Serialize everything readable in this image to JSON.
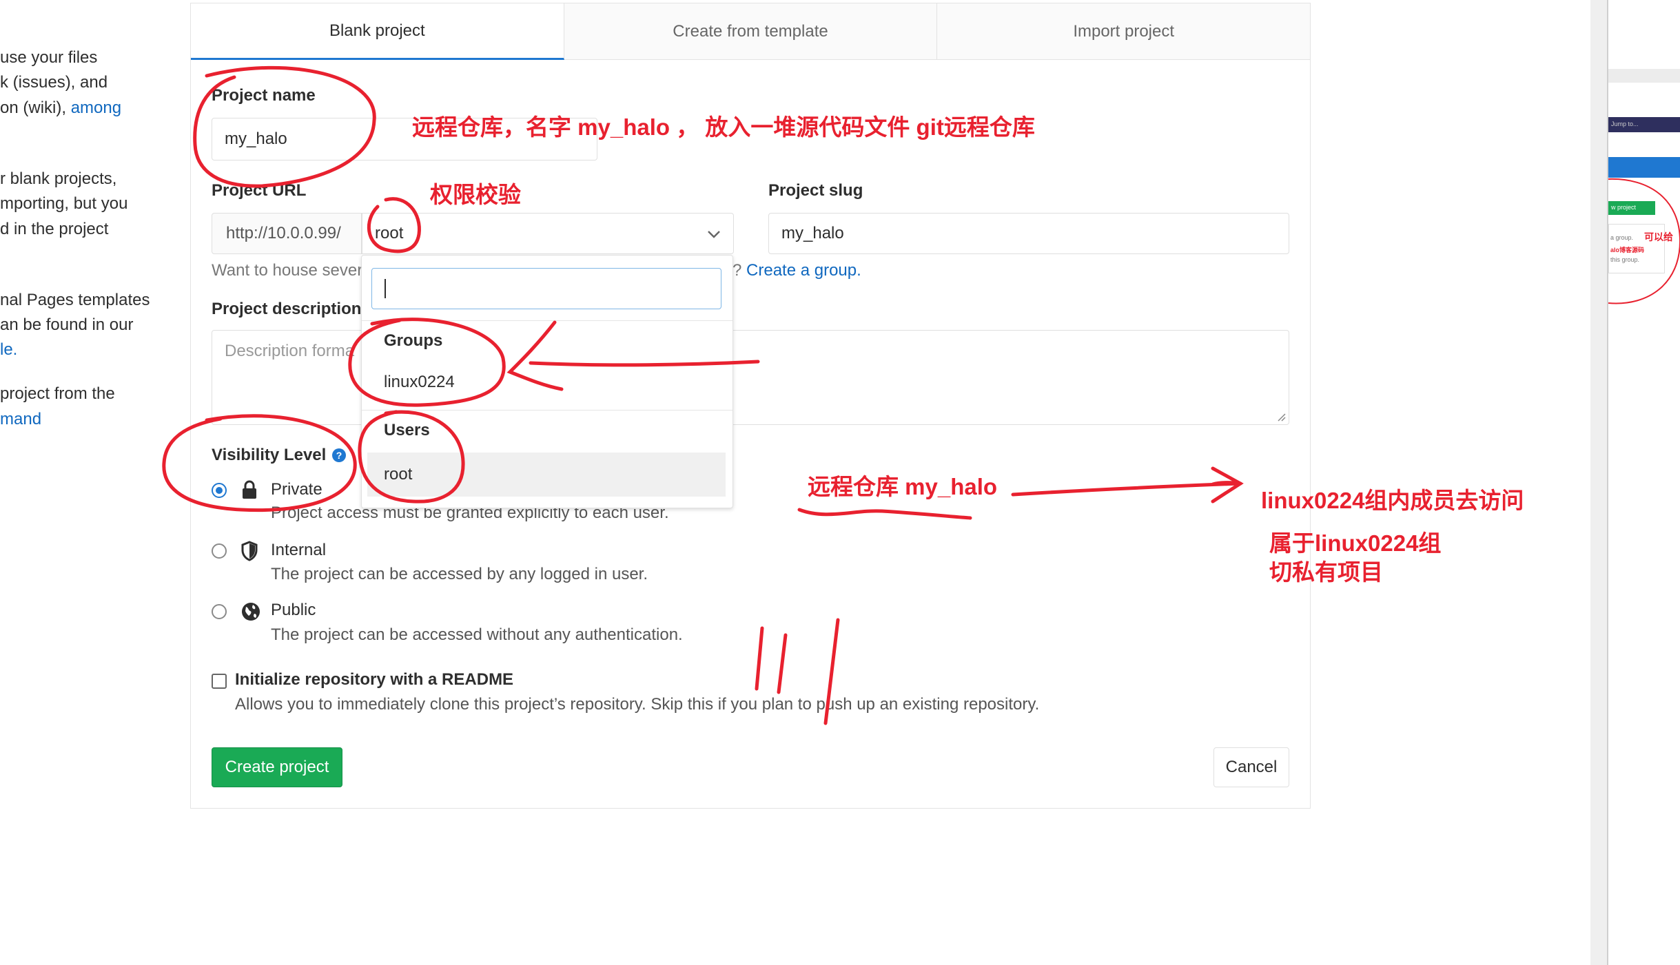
{
  "sidebar_text": [
    {
      "text": "use your files"
    },
    {
      "text": "k (issues), and"
    },
    {
      "text": "on (wiki), ",
      "link": "among"
    },
    {
      "text": "r blank projects,"
    },
    {
      "text": "mporting, but you"
    },
    {
      "text": "d in the project"
    },
    {
      "text": "nal Pages templates"
    },
    {
      "text": "an be found in our"
    },
    {
      "text": "",
      "link": "le."
    },
    {
      "text": "project from the"
    },
    {
      "text": "",
      "link": "mand"
    }
  ],
  "tabs": [
    "Blank project",
    "Create from template",
    "Import project"
  ],
  "form": {
    "project_name_label": "Project name",
    "project_name_value": "my_halo",
    "project_url_label": "Project URL",
    "url_prefix": "http://10.0.0.99/",
    "namespace_value": "root",
    "project_slug_label": "Project slug",
    "project_slug_value": "my_halo",
    "namespace_help_left": "Want to house sever",
    "namespace_help_right": "? ",
    "create_group_link": "Create a group.",
    "description_label": "Project description",
    "description_placeholder": "Description forma",
    "visibility_label": "Visibility Level",
    "visibility": [
      {
        "title": "Private",
        "desc": "Project access must be granted explicitly to each user.",
        "checked": true
      },
      {
        "title": "Internal",
        "desc": "The project can be accessed by any logged in user.",
        "checked": false
      },
      {
        "title": "Public",
        "desc": "The project can be accessed without any authentication.",
        "checked": false
      }
    ],
    "readme_label": "Initialize repository with a README",
    "readme_desc": "Allows you to immediately clone this project’s repository. Skip this if you plan to push up an existing repository.",
    "create_button": "Create project",
    "cancel_button": "Cancel"
  },
  "dropdown": {
    "search_value": "",
    "groups_header": "Groups",
    "groups": [
      "linux0224"
    ],
    "users_header": "Users",
    "users": [
      "root"
    ]
  },
  "annotations": {
    "remote_repo_note": "远程仓库，名字 my_halo ， 放入一堆源代码文件  git远程仓库",
    "permission_note": "权限校验",
    "remote_repo_short": "远程仓库 my_halo",
    "group_access_note": "linux0224组内成员去访问",
    "belongs_group_line1": "属于linux0224组",
    "belongs_group_line2": "切私有项目"
  },
  "thumbnail": {
    "search_text": "Jump to...",
    "button_text": "w project",
    "side_note": "可以给",
    "row1": "a group.",
    "row2": "alo博客源码",
    "row3": "this group."
  },
  "colors": {
    "primary_blue": "#1f78d1",
    "link_blue": "#1068bf",
    "green": "#1aaa55",
    "annotation_red": "#e8212f"
  }
}
